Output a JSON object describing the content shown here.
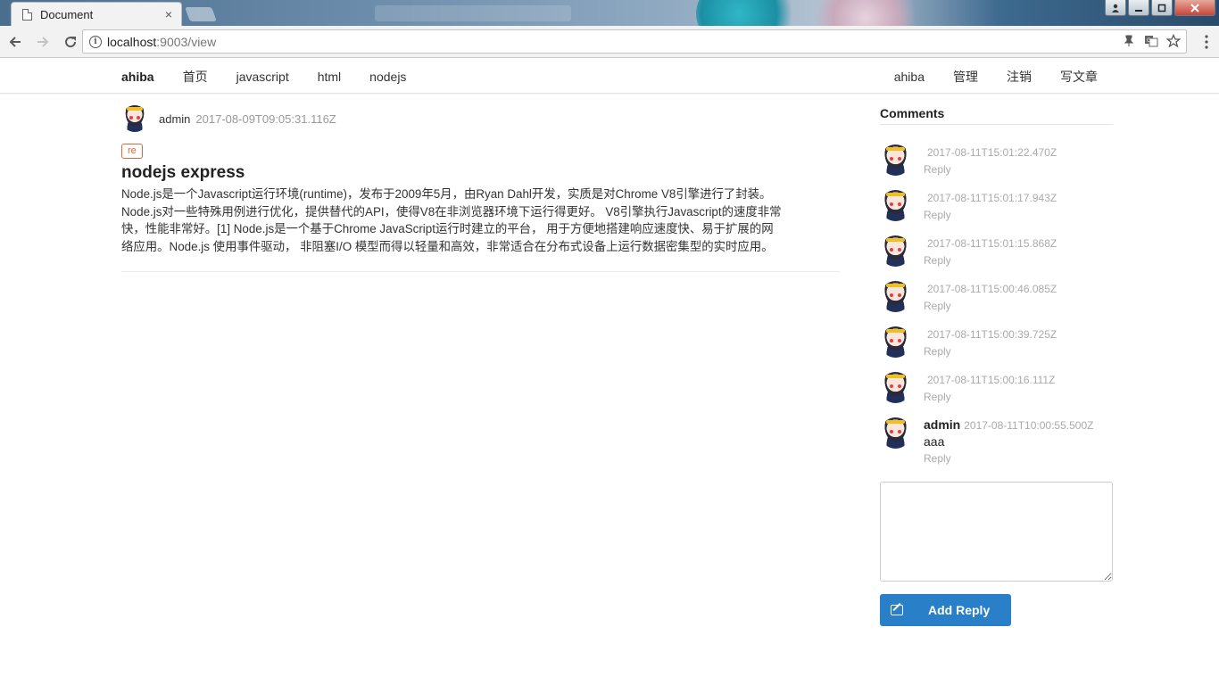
{
  "browser": {
    "tab_title": "Document",
    "tab_close": "×",
    "url_host": "localhost",
    "url_path": ":9003/view",
    "window_controls": [
      "user-icon",
      "minimize-icon",
      "maximize-icon",
      "close-icon"
    ]
  },
  "nav": {
    "brand": "ahiba",
    "left_links": [
      "首页",
      "javascript",
      "html",
      "nodejs"
    ],
    "right_links": [
      "ahiba",
      "管理",
      "注销",
      "写文章"
    ]
  },
  "post": {
    "author": "admin",
    "time": "2017-08-09T09:05:31.116Z",
    "tag": "re",
    "title": "nodejs express",
    "body": "Node.js是一个Javascript运行环境(runtime)，发布于2009年5月，由Ryan Dahl开发，实质是对Chrome V8引擎进行了封装。Node.js对一些特殊用例进行优化，提供替代的API，使得V8在非浏览器环境下运行得更好。 V8引擎执行Javascript的速度非常快，性能非常好。[1] Node.js是一个基于Chrome JavaScript运行时建立的平台， 用于方便地搭建响应速度快、易于扩展的网络应用。Node.js 使用事件驱动， 非阻塞I/O 模型而得以轻量和高效，非常适合在分布式设备上运行数据密集型的实时应用。"
  },
  "comments": {
    "title": "Comments",
    "reply_label": "Reply",
    "items": [
      {
        "user": "",
        "time": "2017-08-11T15:01:22.470Z",
        "text": ""
      },
      {
        "user": "",
        "time": "2017-08-11T15:01:17.943Z",
        "text": ""
      },
      {
        "user": "",
        "time": "2017-08-11T15:01:15.868Z",
        "text": ""
      },
      {
        "user": "",
        "time": "2017-08-11T15:00:46.085Z",
        "text": ""
      },
      {
        "user": "",
        "time": "2017-08-11T15:00:39.725Z",
        "text": ""
      },
      {
        "user": "",
        "time": "2017-08-11T15:00:16.111Z",
        "text": ""
      },
      {
        "user": "admin",
        "time": "2017-08-11T10:00:55.500Z",
        "text": "aaa"
      }
    ]
  },
  "reply_form": {
    "textarea_value": "",
    "button_label": "Add Reply"
  },
  "colors": {
    "tag_accent": "#e0663a",
    "button_primary": "#2a80c8"
  }
}
